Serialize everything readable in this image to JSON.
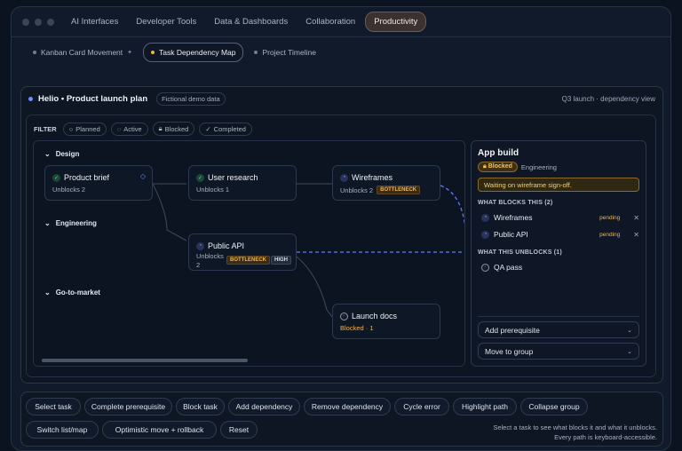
{
  "nav": {
    "tabs": [
      "AI Interfaces",
      "Developer Tools",
      "Data & Dashboards",
      "Collaboration",
      "Productivity"
    ],
    "active": "Productivity"
  },
  "subnav": {
    "items": [
      "Kanban Card Movement",
      "Task Dependency Map",
      "Project Timeline"
    ],
    "active": "Task Dependency Map"
  },
  "panel": {
    "title": "Helio • Product launch plan",
    "badge": "Fictional demo data",
    "right_label": "Q3 launch · dependency view"
  },
  "filter": {
    "label": "FILTER",
    "chips": [
      "Planned",
      "Active",
      "Blocked",
      "Completed"
    ]
  },
  "groups": [
    "Design",
    "Engineering",
    "Go-to-market"
  ],
  "cards": {
    "product_brief": {
      "title": "Product brief",
      "sub": "Unblocks 2"
    },
    "user_research": {
      "title": "User research",
      "sub": "Unblocks 1"
    },
    "wireframes": {
      "title": "Wireframes",
      "sub": "Unblocks 2",
      "tag": "BOTTLENECK"
    },
    "public_api": {
      "title": "Public API",
      "sub_line1": "Unblocks",
      "sub_line2": "2",
      "tag": "BOTTLENECK",
      "priority": "HIGH"
    },
    "launch_docs": {
      "title": "Launch docs",
      "sub": "Blocked · 1"
    }
  },
  "detail": {
    "title": "App build",
    "status": "Blocked",
    "team": "Engineering",
    "note": "Waiting on wireframe sign-off.",
    "blocks_heading": "WHAT BLOCKS THIS (2)",
    "blockers": [
      {
        "name": "Wireframes",
        "state": "pending"
      },
      {
        "name": "Public API",
        "state": "pending"
      }
    ],
    "unblocks_heading": "WHAT THIS UNBLOCKS (1)",
    "unblocks": [
      "QA pass"
    ],
    "add_prereq": "Add prerequisite",
    "move_group": "Move to group"
  },
  "actions": {
    "row1": [
      "Select task",
      "Complete prerequisite",
      "Block task",
      "Add dependency",
      "Remove dependency",
      "Cycle error",
      "Highlight path",
      "Collapse group"
    ],
    "row2": [
      "Switch list/map",
      "Optimistic move + rollback",
      "Reset"
    ],
    "hint1": "Select a task to see what blocks it and what it unblocks.",
    "hint2": "Every path is keyboard-accessible."
  },
  "colors": {
    "accent": "#6d8cff",
    "warning": "#f4b24a",
    "success": "#5fd39a",
    "active_tab": "#3a3130"
  }
}
